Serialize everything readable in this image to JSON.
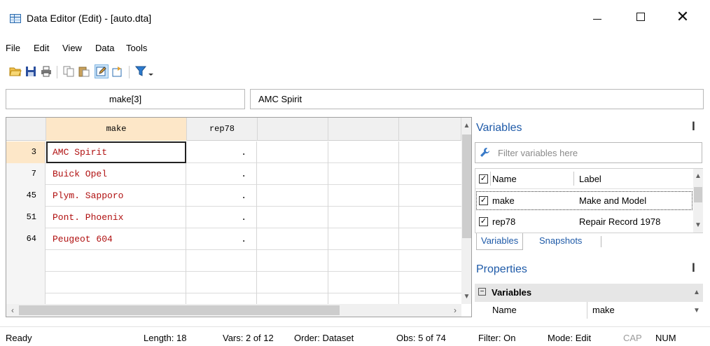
{
  "window": {
    "title": "Data Editor (Edit) - [auto.dta]",
    "icon": "data-grid-icon"
  },
  "menu": [
    "File",
    "Edit",
    "View",
    "Data",
    "Tools"
  ],
  "toolbar": {
    "icons": [
      "open-icon",
      "save-icon",
      "print-icon",
      "copy-icon",
      "paste-icon",
      "edit-mode-icon",
      "browse-mode-icon",
      "filter-icon"
    ],
    "active": "edit-mode-icon"
  },
  "cell_bar": {
    "name": "make[3]",
    "value": "AMC Spirit"
  },
  "grid": {
    "columns": [
      "make",
      "rep78"
    ],
    "rows": [
      {
        "obs": "3",
        "make": "AMC Spirit",
        "rep78": "."
      },
      {
        "obs": "7",
        "make": "Buick Opel",
        "rep78": "."
      },
      {
        "obs": "45",
        "make": "Plym. Sapporo",
        "rep78": "."
      },
      {
        "obs": "51",
        "make": "Pont. Phoenix",
        "rep78": "."
      },
      {
        "obs": "64",
        "make": "Peugeot 604",
        "rep78": "."
      }
    ]
  },
  "variables_panel": {
    "title": "Variables",
    "filter_placeholder": "Filter variables here",
    "headers": {
      "name": "Name",
      "label": "Label"
    },
    "items": [
      {
        "name": "make",
        "label": "Make and Model"
      },
      {
        "name": "rep78",
        "label": "Repair Record 1978"
      }
    ],
    "tabs": [
      "Variables",
      "Snapshots"
    ]
  },
  "properties_panel": {
    "title": "Properties",
    "group": "Variables",
    "rows": [
      {
        "key": "Name",
        "value": "make"
      }
    ]
  },
  "status": {
    "ready": "Ready",
    "length": "Length: 18",
    "vars": "Vars: 2 of 12",
    "order": "Order: Dataset",
    "obs": "Obs: 5 of 74",
    "filter": "Filter: On",
    "mode": "Mode: Edit",
    "cap": "CAP",
    "num": "NUM"
  },
  "colors": {
    "string_text": "#b01010",
    "accent": "#1e5aa8",
    "selected_header": "#fde7c8"
  }
}
